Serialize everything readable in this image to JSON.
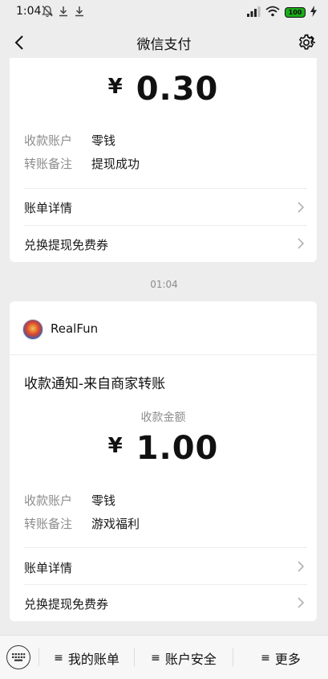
{
  "status_bar": {
    "time": "1:04",
    "battery": "100"
  },
  "nav": {
    "title": "微信支付"
  },
  "card1": {
    "currency": "¥",
    "amount": "0.30",
    "fields": [
      {
        "label": "收款账户",
        "value": "零钱"
      },
      {
        "label": "转账备注",
        "value": "提现成功"
      }
    ],
    "rows": [
      {
        "label": "账单详情"
      },
      {
        "label": "兑换提现免费券"
      }
    ]
  },
  "timestamp": "01:04",
  "card2": {
    "merchant": "RealFun",
    "title": "收款通知-来自商家转账",
    "amount_caption": "收款金额",
    "currency": "¥",
    "amount": "1.00",
    "fields": [
      {
        "label": "收款账户",
        "value": "零钱"
      },
      {
        "label": "转账备注",
        "value": "游戏福利"
      }
    ],
    "rows": [
      {
        "label": "账单详情"
      },
      {
        "label": "兑换提现免费券"
      }
    ]
  },
  "bottom_bar": {
    "items": [
      {
        "label": "我的账单"
      },
      {
        "label": "账户安全"
      },
      {
        "label": "更多"
      }
    ]
  }
}
